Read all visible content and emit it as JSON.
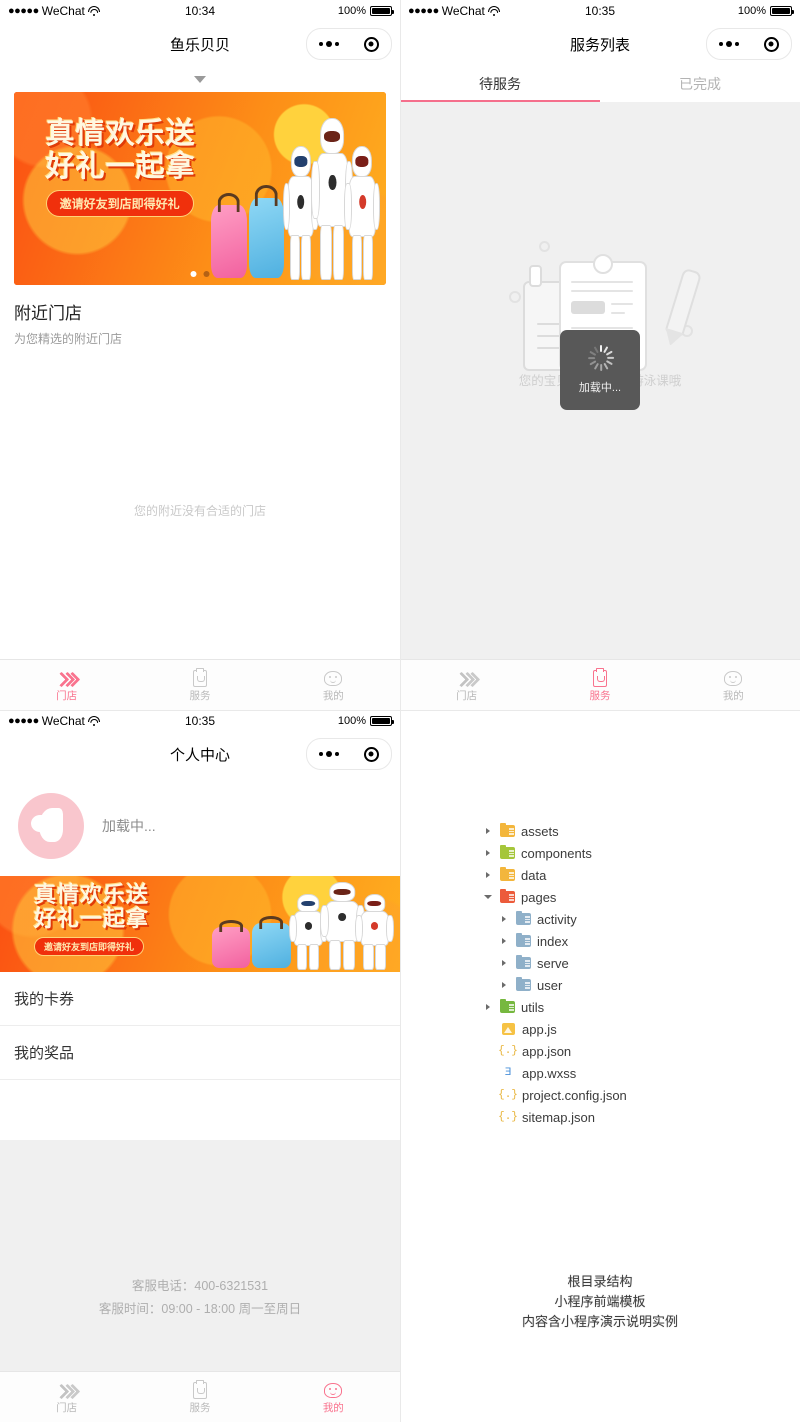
{
  "meta": {
    "accent_pink": "#f9738e",
    "accent_pink_bar": "#f56f8c",
    "bg_gray": "#f0f0f0",
    "text_muted": "#b9b9b9"
  },
  "panel1": {
    "statusbar": {
      "carrier": "WeChat",
      "dots": "●●●●●",
      "time": "10:34",
      "battery_percent": "100%"
    },
    "navbar": {
      "title": "鱼乐贝贝"
    },
    "banner": {
      "line1": "真情欢乐送",
      "line2": "好礼一起拿",
      "pill": "邀请好友到店即得好礼",
      "dot_count": 2,
      "active_dot": 0
    },
    "section": {
      "title": "附近门店",
      "subtitle": "为您精选的附近门店",
      "empty": "您的附近没有合适的门店"
    },
    "tabbar": {
      "items": [
        {
          "label": "门店",
          "icon": "store-icon",
          "active": true
        },
        {
          "label": "服务",
          "icon": "clipboard-icon",
          "active": false
        },
        {
          "label": "我的",
          "icon": "face-icon",
          "active": false
        }
      ]
    }
  },
  "panel2": {
    "statusbar": {
      "carrier": "WeChat",
      "dots": "●●●●●",
      "time": "10:35",
      "battery_percent": "100%"
    },
    "navbar": {
      "title": "服务列表"
    },
    "tabs": [
      {
        "label": "待服务",
        "selected": true
      },
      {
        "label": "已完成",
        "selected": false
      }
    ],
    "empty_message": "您的宝贝还没有报名游泳课哦",
    "loading": {
      "text": "加载中..."
    },
    "tabbar": {
      "items": [
        {
          "label": "门店",
          "icon": "store-icon",
          "active": false
        },
        {
          "label": "服务",
          "icon": "clipboard-icon",
          "active": true
        },
        {
          "label": "我的",
          "icon": "face-icon",
          "active": false
        }
      ]
    }
  },
  "panel3": {
    "statusbar": {
      "carrier": "WeChat",
      "dots": "●●●●●",
      "time": "10:35",
      "battery_percent": "100%"
    },
    "navbar": {
      "title": "个人中心"
    },
    "profile": {
      "loading_text": "加载中...",
      "avatar": "default-avatar"
    },
    "banner": {
      "line1": "真情欢乐送",
      "line2": "好礼一起拿",
      "pill": "邀请好友到店即得好礼"
    },
    "menu": [
      {
        "label": "我的卡券"
      },
      {
        "label": "我的奖品"
      }
    ],
    "footer": {
      "phone_line": "客服电话：400-6321531",
      "hours_line": "客服时间：09:00 - 18:00 周一至周日"
    },
    "tabbar": {
      "items": [
        {
          "label": "门店",
          "icon": "store-icon",
          "active": false
        },
        {
          "label": "服务",
          "icon": "clipboard-icon",
          "active": false
        },
        {
          "label": "我的",
          "icon": "face-icon",
          "active": true
        }
      ]
    }
  },
  "panel4": {
    "tree": [
      {
        "name": "assets",
        "type": "folder",
        "color": "#f3b63c",
        "depth": 0,
        "expanded": false
      },
      {
        "name": "components",
        "type": "folder",
        "color": "#a5c63b",
        "depth": 0,
        "expanded": false
      },
      {
        "name": "data",
        "type": "folder",
        "color": "#f3b63c",
        "depth": 0,
        "expanded": false
      },
      {
        "name": "pages",
        "type": "folder",
        "color": "#ec5b3b",
        "depth": 0,
        "expanded": true
      },
      {
        "name": "activity",
        "type": "folder",
        "color": "#8fb0c9",
        "depth": 1,
        "expanded": false
      },
      {
        "name": "index",
        "type": "folder",
        "color": "#8fb0c9",
        "depth": 1,
        "expanded": false
      },
      {
        "name": "serve",
        "type": "folder",
        "color": "#8fb0c9",
        "depth": 1,
        "expanded": false
      },
      {
        "name": "user",
        "type": "folder",
        "color": "#8fb0c9",
        "depth": 1,
        "expanded": false
      },
      {
        "name": "utils",
        "type": "folder",
        "color": "#76b83f",
        "depth": 0,
        "expanded": false
      },
      {
        "name": "app.js",
        "type": "js",
        "color": "#f6c244",
        "depth": 0,
        "glyph": ""
      },
      {
        "name": "app.json",
        "type": "json",
        "color": "#e8b43a",
        "depth": 0,
        "glyph": "{.}"
      },
      {
        "name": "app.wxss",
        "type": "css",
        "color": "#4a90d9",
        "depth": 0,
        "glyph": "Ǝ"
      },
      {
        "name": "project.config.json",
        "type": "json",
        "color": "#e8b43a",
        "depth": 0,
        "glyph": "{.}"
      },
      {
        "name": "sitemap.json",
        "type": "json",
        "color": "#e8b43a",
        "depth": 0,
        "glyph": "{.}"
      }
    ],
    "caption": {
      "line1": "根目录结构",
      "line2": "小程序前端模板",
      "line3": "内容含小程序演示说明实例"
    }
  }
}
